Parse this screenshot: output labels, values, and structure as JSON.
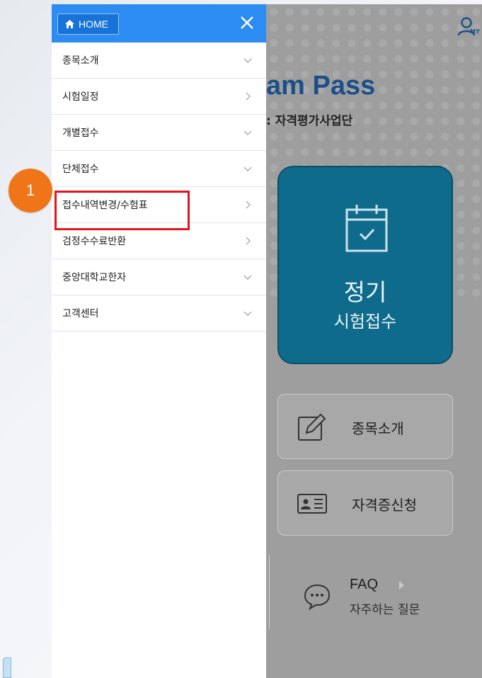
{
  "background": {
    "brand_title": "am Pass",
    "brand_subtitle": ": 자격평가사업단",
    "my_label": "MY",
    "regular_card": {
      "title": "정기",
      "subtitle": "시험접수"
    },
    "buttons": [
      {
        "label": "종목소개",
        "icon": "edit-icon"
      },
      {
        "label": "자격증신청",
        "icon": "id-card-icon"
      }
    ],
    "faq": {
      "title": "FAQ",
      "subtitle": "자주하는 질문",
      "icon": "chat-bubble-icon"
    }
  },
  "drawer": {
    "home_label": "HOME",
    "menu": [
      {
        "label": "종목소개",
        "chevron": "down"
      },
      {
        "label": "시험일정",
        "chevron": "right"
      },
      {
        "label": "개별접수",
        "chevron": "down"
      },
      {
        "label": "단체접수",
        "chevron": "down"
      },
      {
        "label": "접수내역변경/수험표",
        "chevron": "right"
      },
      {
        "label": "검정수수료반환",
        "chevron": "right"
      },
      {
        "label": "중앙대학교한자",
        "chevron": "down"
      },
      {
        "label": "고객센터",
        "chevron": "down"
      }
    ]
  },
  "annotation": {
    "step": "1"
  },
  "colors": {
    "drawer_header": "#2c8cf2",
    "home_button": "#1873d8",
    "highlight": "#e4141b",
    "badge": "#f07518",
    "regular_card": "#0f6b8b",
    "overlay_gray": "#9e9e9e"
  }
}
